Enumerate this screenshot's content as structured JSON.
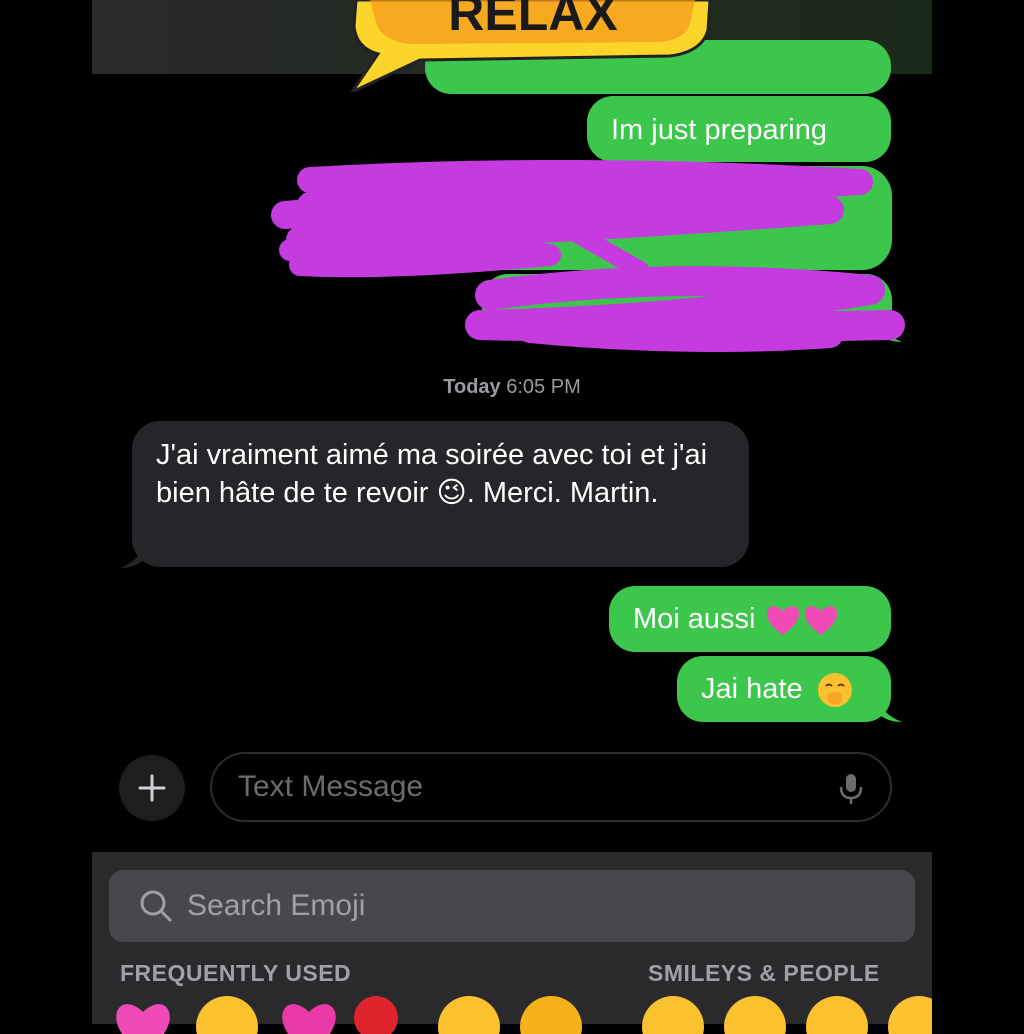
{
  "sticker": {
    "text": "RELAX"
  },
  "messages": {
    "sent_1": "Im just preparing",
    "timestamp_day": "Today",
    "timestamp_time": "6:05 PM",
    "received_1": "J'ai vraiment aimé ma soirée avec toi et j'ai bien hâte de te revoir 😉. Merci. Martin.",
    "sent_2": "Moi aussi",
    "sent_3": "Jai hate"
  },
  "composer": {
    "placeholder": "Text Message"
  },
  "emoji_keyboard": {
    "search_placeholder": "Search Emoji",
    "section_frequent": "FREQUENTLY USED",
    "section_smileys": "SMILEYS & PEOPLE"
  },
  "colors": {
    "sent_bubble": "#3cc74c",
    "received_bubble": "#26262a",
    "scribble": "#c63be0"
  },
  "icons": [
    "plus-icon",
    "microphone-icon",
    "search-icon",
    "heart-emoji",
    "wink-emoji",
    "hand-over-mouth-emoji"
  ]
}
